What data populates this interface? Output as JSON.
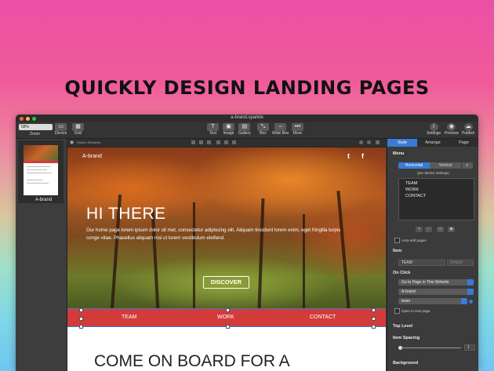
{
  "promo": {
    "headline": "QUICKLY DESIGN LANDING PAGES"
  },
  "window": {
    "title": "a-brand.sparkle",
    "zoom_value": "58%",
    "zoom_label": "Zoom",
    "left_tools": [
      "Device",
      "Grid"
    ],
    "center_tools": [
      "Text",
      "Image",
      "Gallery",
      "Box",
      "Wide Box",
      "More"
    ],
    "right_tools": [
      "Settings",
      "Preview",
      "Publish"
    ],
    "traffic_lights": [
      "#fc5f57",
      "#fdbc2e",
      "#28c840"
    ]
  },
  "pages": {
    "thumb_label": "A-brand"
  },
  "canvas_bar": {
    "hidden_label": "Hidden Elements"
  },
  "site": {
    "brand": "A-brand",
    "social": [
      "t",
      "f"
    ],
    "hero_title": "HI THERE",
    "hero_text": "Our home page lorem ipsum dolor sit met, consectetur adipiscing elit. Aliquam tincidunt lorem enim, eget fringilla turpis conge vitae. Phasellus aliquam nisi ut lorem vestibulum eleifend.",
    "cta": "DISCOVER",
    "menu": [
      "TEAM",
      "WORK",
      "CONTACT"
    ],
    "section_title": "COME ON BOARD FOR A"
  },
  "inspector": {
    "tabs": [
      "Style",
      "Arrange",
      "Page"
    ],
    "active_tab": "Style",
    "menu_label": "Menu",
    "orientation": [
      "Horizontal",
      "Vertical"
    ],
    "orientation_selected": "Horizontal",
    "per_device": "(per-device settings)",
    "menu_items": [
      "TEAM",
      "WORK",
      "CONTACT"
    ],
    "list_buttons": [
      "+",
      "−",
      "▭",
      "◉"
    ],
    "auto_add": "Auto-add pages",
    "item_label": "Item",
    "item_value": "TEAM",
    "item_default": "Default",
    "onclick_label": "On Click",
    "onclick_action": "Go to Page in This Website",
    "onclick_page": "A-brand",
    "onclick_anchor": "team",
    "open_new": "Open in new page",
    "top_level": "Top Level",
    "item_spacing": "Item Spacing",
    "spacing_value": "1",
    "background": "Background"
  }
}
